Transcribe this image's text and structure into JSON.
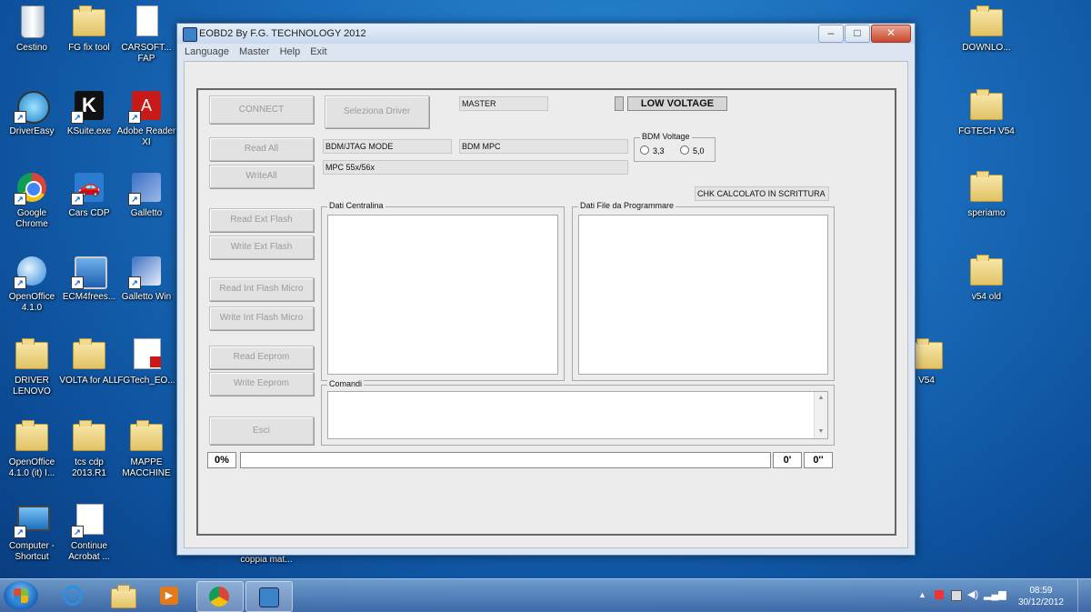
{
  "desktop": {
    "icons_left": [
      {
        "label": "Cestino",
        "icon": "recycle-bin-icon"
      },
      {
        "label": "FG fix tool",
        "icon": "folder-icon"
      },
      {
        "label": "CARSOFT... FAP",
        "icon": "document-icon"
      },
      {
        "label": "DriverEasy",
        "icon": "drivereasy-icon"
      },
      {
        "label": "KSuite.exe",
        "icon": "ksuite-icon"
      },
      {
        "label": "Adobe Reader XI",
        "icon": "adobe-reader-icon"
      },
      {
        "label": "Google Chrome",
        "icon": "chrome-icon"
      },
      {
        "label": "Cars CDP",
        "icon": "car-icon"
      },
      {
        "label": "Galletto",
        "icon": "galletto-icon"
      },
      {
        "label": "OpenOffice 4.1.0",
        "icon": "openoffice-icon"
      },
      {
        "label": "ECM4frees...",
        "icon": "ecm-icon"
      },
      {
        "label": "Galletto Win",
        "icon": "galletto-win-icon"
      },
      {
        "label": "DRIVER LENOVO",
        "icon": "folder-icon"
      },
      {
        "label": "VOLTA for ALL",
        "icon": "folder-icon"
      },
      {
        "label": "FGTech_EO...",
        "icon": "pdf-document-icon"
      },
      {
        "label": "OpenOffice 4.1.0 (it) I...",
        "icon": "folder-icon"
      },
      {
        "label": "tcs cdp 2013.R1",
        "icon": "folder-icon"
      },
      {
        "label": "MAPPE MACCHINE",
        "icon": "folder-icon"
      },
      {
        "label": "Computer - Shortcut",
        "icon": "computer-icon"
      },
      {
        "label": "Continue Acrobat ...",
        "icon": "acrobat-doc-icon"
      },
      {
        "label": "coppia mat...",
        "icon": "document-icon"
      }
    ],
    "icons_right": [
      {
        "label": "DOWNLO...",
        "icon": "folder-icon"
      },
      {
        "label": "FGTECH V54",
        "icon": "folder-icon"
      },
      {
        "label": "speriamo",
        "icon": "folder-icon"
      },
      {
        "label": "v54 old",
        "icon": "folder-icon"
      },
      {
        "label": "V54",
        "icon": "folder-icon"
      }
    ]
  },
  "window": {
    "title": "EOBD2 By F.G. TECHNOLOGY 2012",
    "controls": {
      "minimize": "–",
      "maximize": "□",
      "close": "✕"
    },
    "menu": [
      "Language",
      "Master",
      "Help",
      "Exit"
    ]
  },
  "panel": {
    "buttons": {
      "connect": "CONNECT",
      "seleziona": "Seleziona Driver",
      "read_all": "Read All",
      "write_all": "WriteAll",
      "read_ext": "Read Ext Flash",
      "write_ext": "Write Ext Flash",
      "read_int": "Read Int Flash Micro",
      "write_int": "Write Int Flash Micro",
      "read_eeprom": "Read Eeprom",
      "write_eeprom": "Write Eeprom",
      "esci": "Esci"
    },
    "master_field": "MASTER",
    "low_voltage": "LOW VOLTAGE",
    "mode_field": "BDM/JTAG  MODE",
    "bdm_mpc_field": "BDM MPC",
    "mpc_field": "MPC 55x/56x",
    "bdm_voltage": {
      "title": "BDM Voltage",
      "opt1": "3,3",
      "opt2": "5,0"
    },
    "chk_field": "CHK CALCOLATO IN SCRITTURA",
    "group_centralina": "Dati Centralina",
    "group_file": "Dati File da Programmare",
    "group_comandi": "Comandi",
    "progress": {
      "percent_label": "0%",
      "value": 0
    },
    "time_min": "0'",
    "time_sec": "0''"
  },
  "taskbar": {
    "clock_time": "08:59",
    "clock_date": "30/12/2012"
  }
}
